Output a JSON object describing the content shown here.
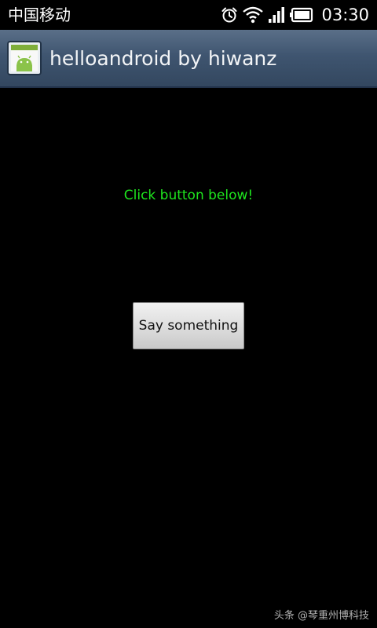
{
  "status_bar": {
    "carrier": "中国移动",
    "time": "03:30",
    "icons": [
      "alarm-icon",
      "wifi-icon",
      "signal-icon",
      "battery-icon"
    ]
  },
  "title_bar": {
    "title": "helloandroid by hiwanz",
    "icon": "android-app-icon"
  },
  "main": {
    "prompt_text": "Click button below!",
    "button_label": "Say something"
  },
  "watermark": {
    "text": "头条 @琴重州博科技"
  },
  "colors": {
    "prompt_text": "#1ee51e",
    "title_bar": "#3f5570",
    "background": "#000000"
  }
}
